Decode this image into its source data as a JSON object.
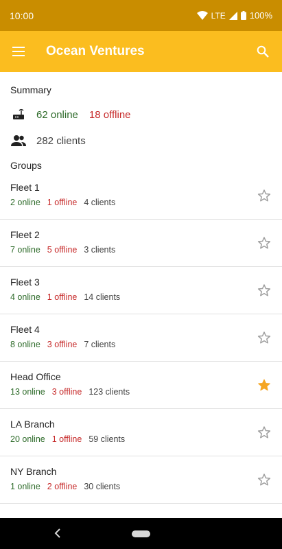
{
  "status_bar": {
    "time": "10:00",
    "network": "LTE",
    "battery": "100%",
    "icons": [
      "wifi-icon",
      "signal-icon",
      "battery-icon"
    ]
  },
  "app_bar": {
    "title": "Ocean Ventures",
    "menu_icon": "menu-icon",
    "search_icon": "search-icon",
    "color": "#fbbd1f"
  },
  "summary": {
    "header": "Summary",
    "online": "62 online",
    "offline": "18 offline",
    "clients": "282 clients",
    "icons": [
      "router-icon",
      "people-icon"
    ]
  },
  "groups": {
    "header": "Groups",
    "items": [
      {
        "name": "Fleet 1",
        "online": "2 online",
        "offline": "1 offline",
        "clients": "4 clients",
        "starred": false
      },
      {
        "name": "Fleet 2",
        "online": "7 online",
        "offline": "5 offline",
        "clients": "3 clients",
        "starred": false
      },
      {
        "name": "Fleet 3",
        "online": "4 online",
        "offline": "1 offline",
        "clients": "14 clients",
        "starred": false
      },
      {
        "name": "Fleet 4",
        "online": "8 online",
        "offline": "3 offline",
        "clients": "7 clients",
        "starred": false
      },
      {
        "name": "Head Office",
        "online": "13 online",
        "offline": "3 offline",
        "clients": "123 clients",
        "starred": true
      },
      {
        "name": "LA Branch",
        "online": "20 online",
        "offline": "1 offline",
        "clients": "59 clients",
        "starred": false
      },
      {
        "name": "NY Branch",
        "online": "1 online",
        "offline": "2 offline",
        "clients": "30 clients",
        "starred": false
      }
    ]
  },
  "colors": {
    "online": "#2e6b2a",
    "offline": "#c62828",
    "star_active": "#f5a623",
    "star_inactive": "#9e9e9e"
  }
}
